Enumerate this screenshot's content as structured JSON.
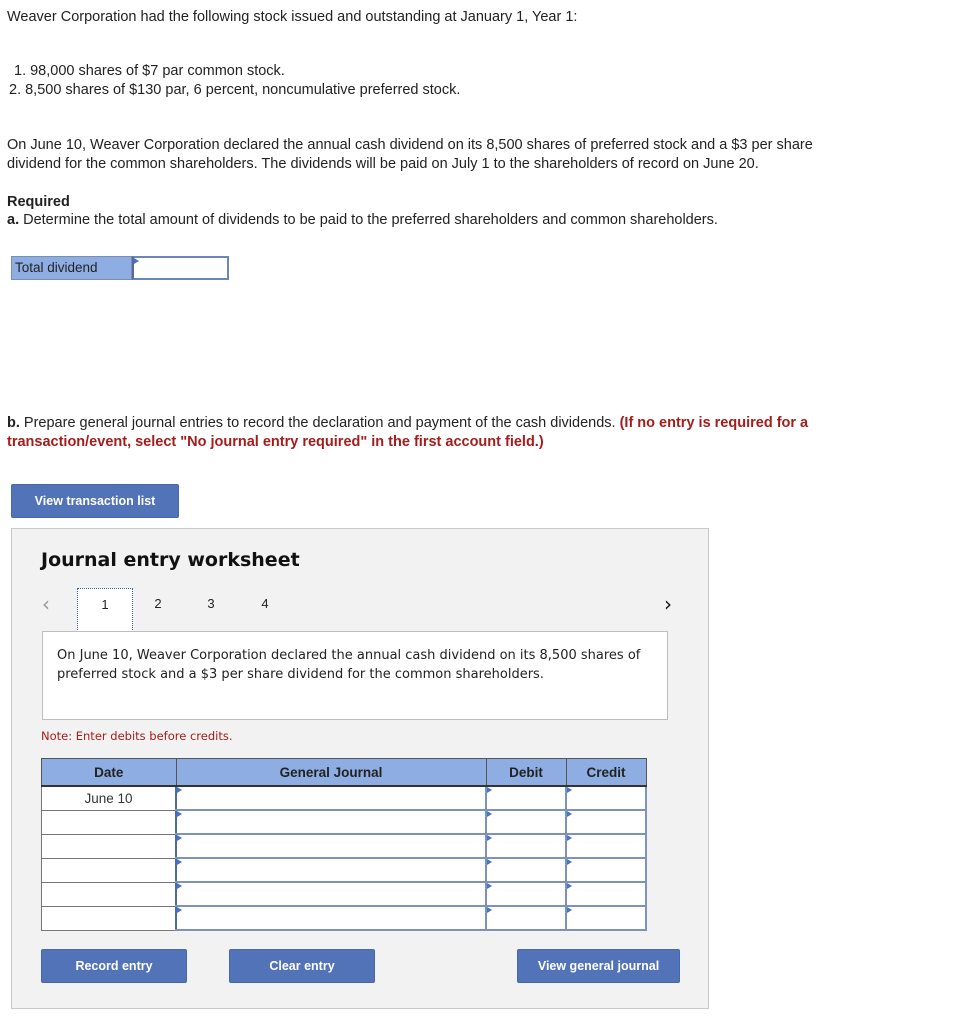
{
  "intro": "Weaver Corporation had the following stock issued and outstanding at January 1, Year 1:",
  "stock_items": [
    "1. 98,000 shares of $7 par common stock.",
    "2. 8,500 shares of $130 par, 6 percent, noncumulative preferred stock."
  ],
  "scenario_line1": "On June 10, Weaver Corporation declared the annual cash dividend on its 8,500 shares of preferred stock and a $3 per share",
  "scenario_line2": "dividend for the common shareholders. The dividends will be paid on July 1 to the shareholders of record on June 20.",
  "required_heading": "Required",
  "part_a": {
    "label": "a.",
    "text": " Determine the total amount of dividends to be paid to the preferred shareholders and common shareholders.",
    "total_dividend_label": "Total dividend",
    "total_dividend_value": ""
  },
  "part_b": {
    "label": "b.",
    "text": " Prepare general journal entries to record the declaration and payment of the cash dividends. ",
    "instruction_line1": "(If no entry is required for a",
    "instruction_line2": "transaction/event, select \"No journal entry required\" in the first account field.)"
  },
  "view_transaction_list_label": "View transaction list",
  "worksheet": {
    "title": "Journal entry worksheet",
    "tabs": [
      "1",
      "2",
      "3",
      "4"
    ],
    "active_tab": "1",
    "description": "On June 10, Weaver Corporation declared the annual cash dividend on its 8,500 shares of preferred stock and a $3 per share dividend for the common shareholders.",
    "note": "Note: Enter debits before credits.",
    "table": {
      "headers": [
        "Date",
        "General Journal",
        "Debit",
        "Credit"
      ],
      "rows": [
        {
          "date": "June 10",
          "account": "",
          "debit": "",
          "credit": ""
        },
        {
          "date": "",
          "account": "",
          "debit": "",
          "credit": ""
        },
        {
          "date": "",
          "account": "",
          "debit": "",
          "credit": ""
        },
        {
          "date": "",
          "account": "",
          "debit": "",
          "credit": ""
        },
        {
          "date": "",
          "account": "",
          "debit": "",
          "credit": ""
        },
        {
          "date": "",
          "account": "",
          "debit": "",
          "credit": ""
        }
      ]
    },
    "buttons": {
      "record": "Record entry",
      "clear": "Clear entry",
      "view_journal": "View general journal"
    }
  },
  "colors": {
    "accent_blue": "#5273b8",
    "header_blue": "#8eaee3",
    "instruction_red": "#a51c1c"
  }
}
